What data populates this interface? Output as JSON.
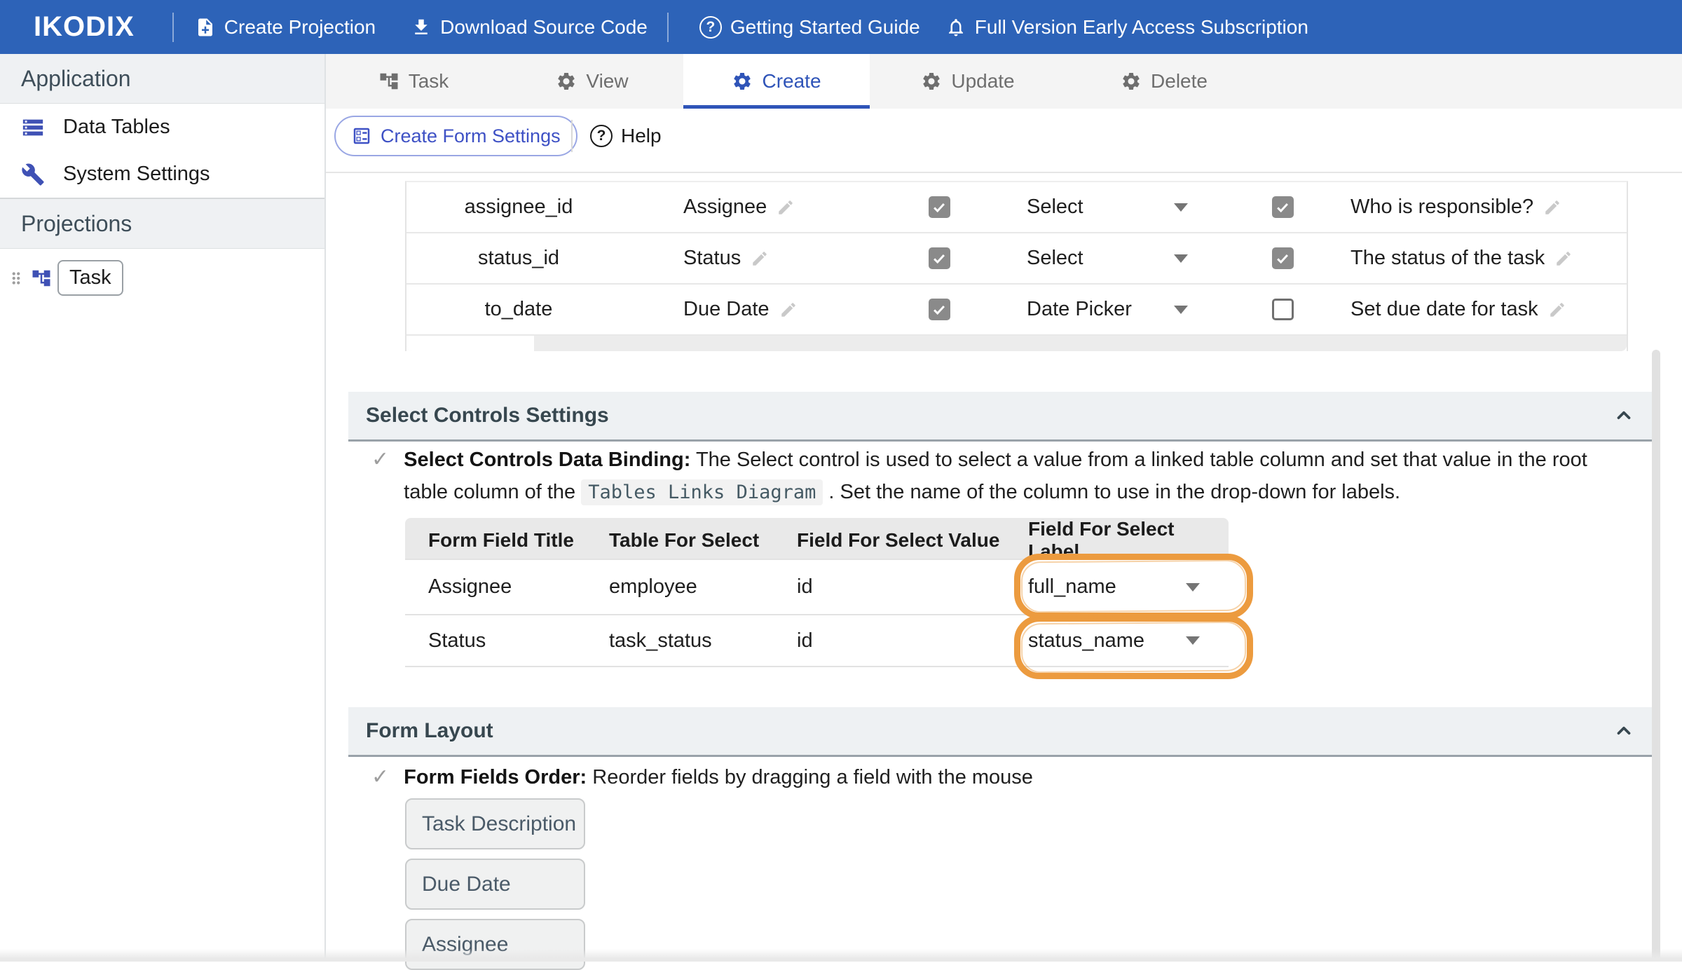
{
  "navbar": {
    "logo": "IKODIX",
    "items": [
      {
        "icon": "note-add-icon",
        "label": "Create Projection"
      },
      {
        "icon": "download-icon",
        "label": "Download Source Code"
      },
      {
        "icon": "help-circle-icon",
        "label": "Getting Started Guide"
      },
      {
        "icon": "bell-icon",
        "label": "Full Version Early Access Subscription"
      }
    ]
  },
  "sidebar": {
    "sections": [
      {
        "title": "Application",
        "items": [
          {
            "icon": "data-tables-icon",
            "label": "Data Tables"
          },
          {
            "icon": "wrench-icon",
            "label": "System Settings"
          }
        ]
      },
      {
        "title": "Projections",
        "items": [
          {
            "icon": "tree-icon",
            "label": "Task",
            "draggable": true
          }
        ]
      }
    ]
  },
  "tabs": [
    {
      "icon": "tree-icon",
      "label": "Task",
      "active": false
    },
    {
      "icon": "gear-icon",
      "label": "View",
      "active": false
    },
    {
      "icon": "gear-icon",
      "label": "Create",
      "active": true
    },
    {
      "icon": "gear-icon",
      "label": "Update",
      "active": false
    },
    {
      "icon": "gear-icon",
      "label": "Delete",
      "active": false
    }
  ],
  "toolbar": {
    "create_form_settings_label": "Create Form Settings",
    "help_label": "Help"
  },
  "glyphs": {
    "question": "?",
    "check": "✓"
  },
  "fields_table": {
    "rows": [
      {
        "field_name": "assignee_id",
        "title": "Assignee",
        "visible": true,
        "control": "Select",
        "required": true,
        "description": "Who is responsible?"
      },
      {
        "field_name": "status_id",
        "title": "Status",
        "visible": true,
        "control": "Select",
        "required": true,
        "description": "The status of the task"
      },
      {
        "field_name": "to_date",
        "title": "Due Date",
        "visible": true,
        "control": "Date Picker",
        "required": false,
        "description": "Set due date for task"
      }
    ]
  },
  "select_controls_settings": {
    "title": "Select Controls Settings",
    "hint_label": "Select Controls Data Binding:",
    "hint_text_before_chip": " The Select control is used to select a value from a linked table column and set that value in the root table column of the ",
    "chip": "Tables Links Diagram",
    "hint_text_after_chip": " . Set the name of the column to use in the drop-down for labels.",
    "table": {
      "headers": [
        "Form Field Title",
        "Table For Select",
        "Field For Select Value",
        "Field For Select Label"
      ],
      "rows": [
        {
          "form_field_title": "Assignee",
          "table_for_select": "employee",
          "field_for_select_value": "id",
          "field_for_select_label": "full_name"
        },
        {
          "form_field_title": "Status",
          "table_for_select": "task_status",
          "field_for_select_value": "id",
          "field_for_select_label": "status_name"
        }
      ]
    }
  },
  "form_layout": {
    "title": "Form Layout",
    "hint_label": "Form Fields Order:",
    "hint_text": " Reorder fields by dragging a field with the mouse",
    "fields": [
      "Task Description",
      "Due Date",
      "Assignee"
    ]
  },
  "colors": {
    "navbar_blue": "#2d63b8",
    "active_tab_blue": "#2f54b8",
    "button_blue": "#3e51c5",
    "sidebar_icon_blue": "#3f51b5",
    "annotation_orange": "#ec9b3f",
    "section_title_slate": "#37474f"
  }
}
